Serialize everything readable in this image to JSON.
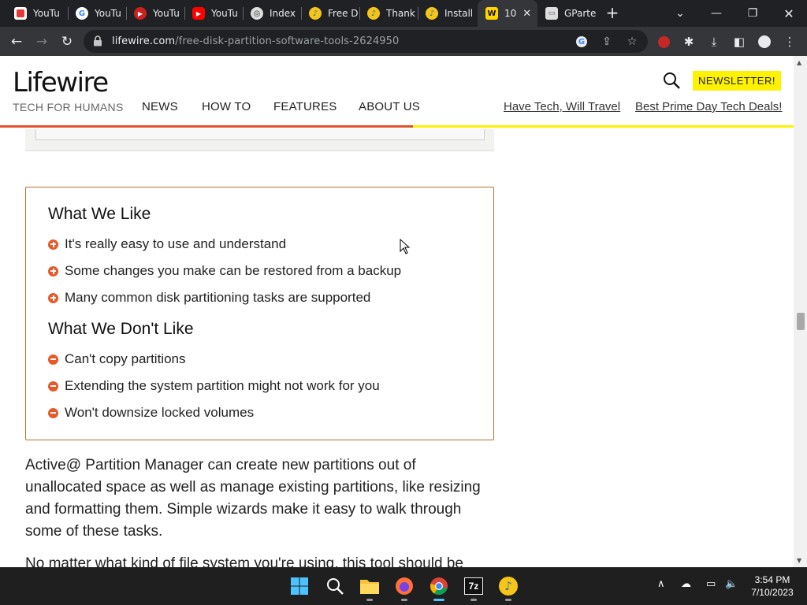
{
  "browser": {
    "tabs": [
      {
        "label": "YouTu",
        "icon": "youtube-music-icon"
      },
      {
        "label": "YouTu",
        "icon": "google-icon"
      },
      {
        "label": "YouTu",
        "icon": "youtube-music-icon"
      },
      {
        "label": "YouTu",
        "icon": "youtube-icon"
      },
      {
        "label": "Index",
        "icon": "index-icon"
      },
      {
        "label": "Free D",
        "icon": "sound-icon"
      },
      {
        "label": "Thank",
        "icon": "sound-icon"
      },
      {
        "label": "Install",
        "icon": "sound-icon"
      },
      {
        "label": "10",
        "icon": "lifewire-icon",
        "active": true
      },
      {
        "label": "GParte",
        "icon": "gparted-icon"
      }
    ],
    "url_domain": "lifewire.com",
    "url_path": "/free-disk-partition-software-tools-2624950"
  },
  "site": {
    "logo": "Lifewire",
    "tagline": "TECH FOR HUMANS",
    "nav": [
      "NEWS",
      "HOW TO",
      "FEATURES",
      "ABOUT US"
    ],
    "promos": [
      "Have Tech, Will Travel",
      "Best Prime Day Tech Deals!"
    ],
    "newsletter_label": "NEWSLETTER!",
    "reading_progress_percent": 52
  },
  "article": {
    "likes_title": "What We Like",
    "likes": [
      "It's really easy to use and understand",
      "Some changes you make can be restored from a backup",
      "Many common disk partitioning tasks are supported"
    ],
    "dislikes_title": "What We Don't Like",
    "dislikes": [
      "Can't copy partitions",
      "Extending the system partition might not work for you",
      "Won't downsize locked volumes"
    ],
    "para1_lines": [
      "Active@ Partition Manager can create new partitions out of",
      "unallocated space as well as manage existing partitions, like resizing",
      "and formatting them. Simple wizards make it easy to walk through",
      "some of these tasks."
    ],
    "para2_partial": "No matter what kind of file system you're using, this tool should be"
  },
  "taskbar": {
    "time": "3:54 PM",
    "date": "7/10/2023",
    "app_7z_label": "7z"
  },
  "colors": {
    "accent_orange": "#e8592a",
    "newsletter_yellow": "#fff200",
    "box_border": "#b5722a"
  }
}
